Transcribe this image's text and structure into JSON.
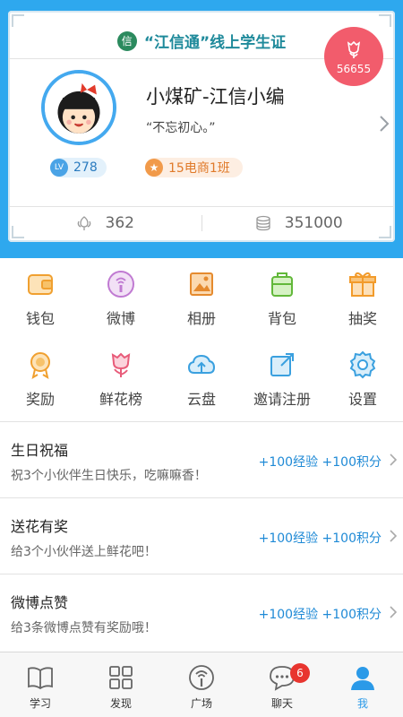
{
  "profile_card": {
    "title": "“江信通”线上学生证",
    "logo_text": "信",
    "flower_count": "56655",
    "user_name": "小煤矿-江信小编",
    "motto": "“不忘初心。”",
    "level_label": "LV",
    "level": "278",
    "class_icon_text": "★",
    "class_name": "15电商1班",
    "stats": [
      {
        "icon": "flower-outline-icon",
        "value": "362"
      },
      {
        "icon": "coins-icon",
        "value": "351000"
      }
    ]
  },
  "grid": [
    {
      "label": "钱包",
      "icon": "wallet-icon"
    },
    {
      "label": "微博",
      "icon": "weibo-icon"
    },
    {
      "label": "相册",
      "icon": "album-icon"
    },
    {
      "label": "背包",
      "icon": "backpack-icon"
    },
    {
      "label": "抽奖",
      "icon": "gift-icon"
    },
    {
      "label": "奖励",
      "icon": "medal-icon"
    },
    {
      "label": "鲜花榜",
      "icon": "tulip-icon"
    },
    {
      "label": "云盘",
      "icon": "cloud-upload-icon"
    },
    {
      "label": "邀请注册",
      "icon": "share-icon"
    },
    {
      "label": "设置",
      "icon": "gear-icon"
    }
  ],
  "tasks": [
    {
      "title": "生日祝福",
      "desc": "祝3个小伙伴生日快乐，吃嘛嘛香！",
      "reward": "+100经验 +100积分"
    },
    {
      "title": "送花有奖",
      "desc": "给3个小伙伴送上鲜花吧！",
      "reward": "+100经验 +100积分"
    },
    {
      "title": "微博点赞",
      "desc": "给3条微博点赞有奖励哦！",
      "reward": "+100经验 +100积分"
    }
  ],
  "bottom_nav": [
    {
      "label": "学习",
      "icon": "book-icon"
    },
    {
      "label": "发现",
      "icon": "grid-icon"
    },
    {
      "label": "广场",
      "icon": "broadcast-icon"
    },
    {
      "label": "聊天",
      "icon": "chat-icon",
      "badge": "6"
    },
    {
      "label": "我",
      "icon": "user-icon",
      "active": true
    }
  ],
  "colors": {
    "header_bg": "#2ea8ee",
    "accent_blue": "#2b9ae8",
    "flower_red": "#f25c6c",
    "reward_blue": "#1f8ad6",
    "badge_red": "#e8352f"
  }
}
